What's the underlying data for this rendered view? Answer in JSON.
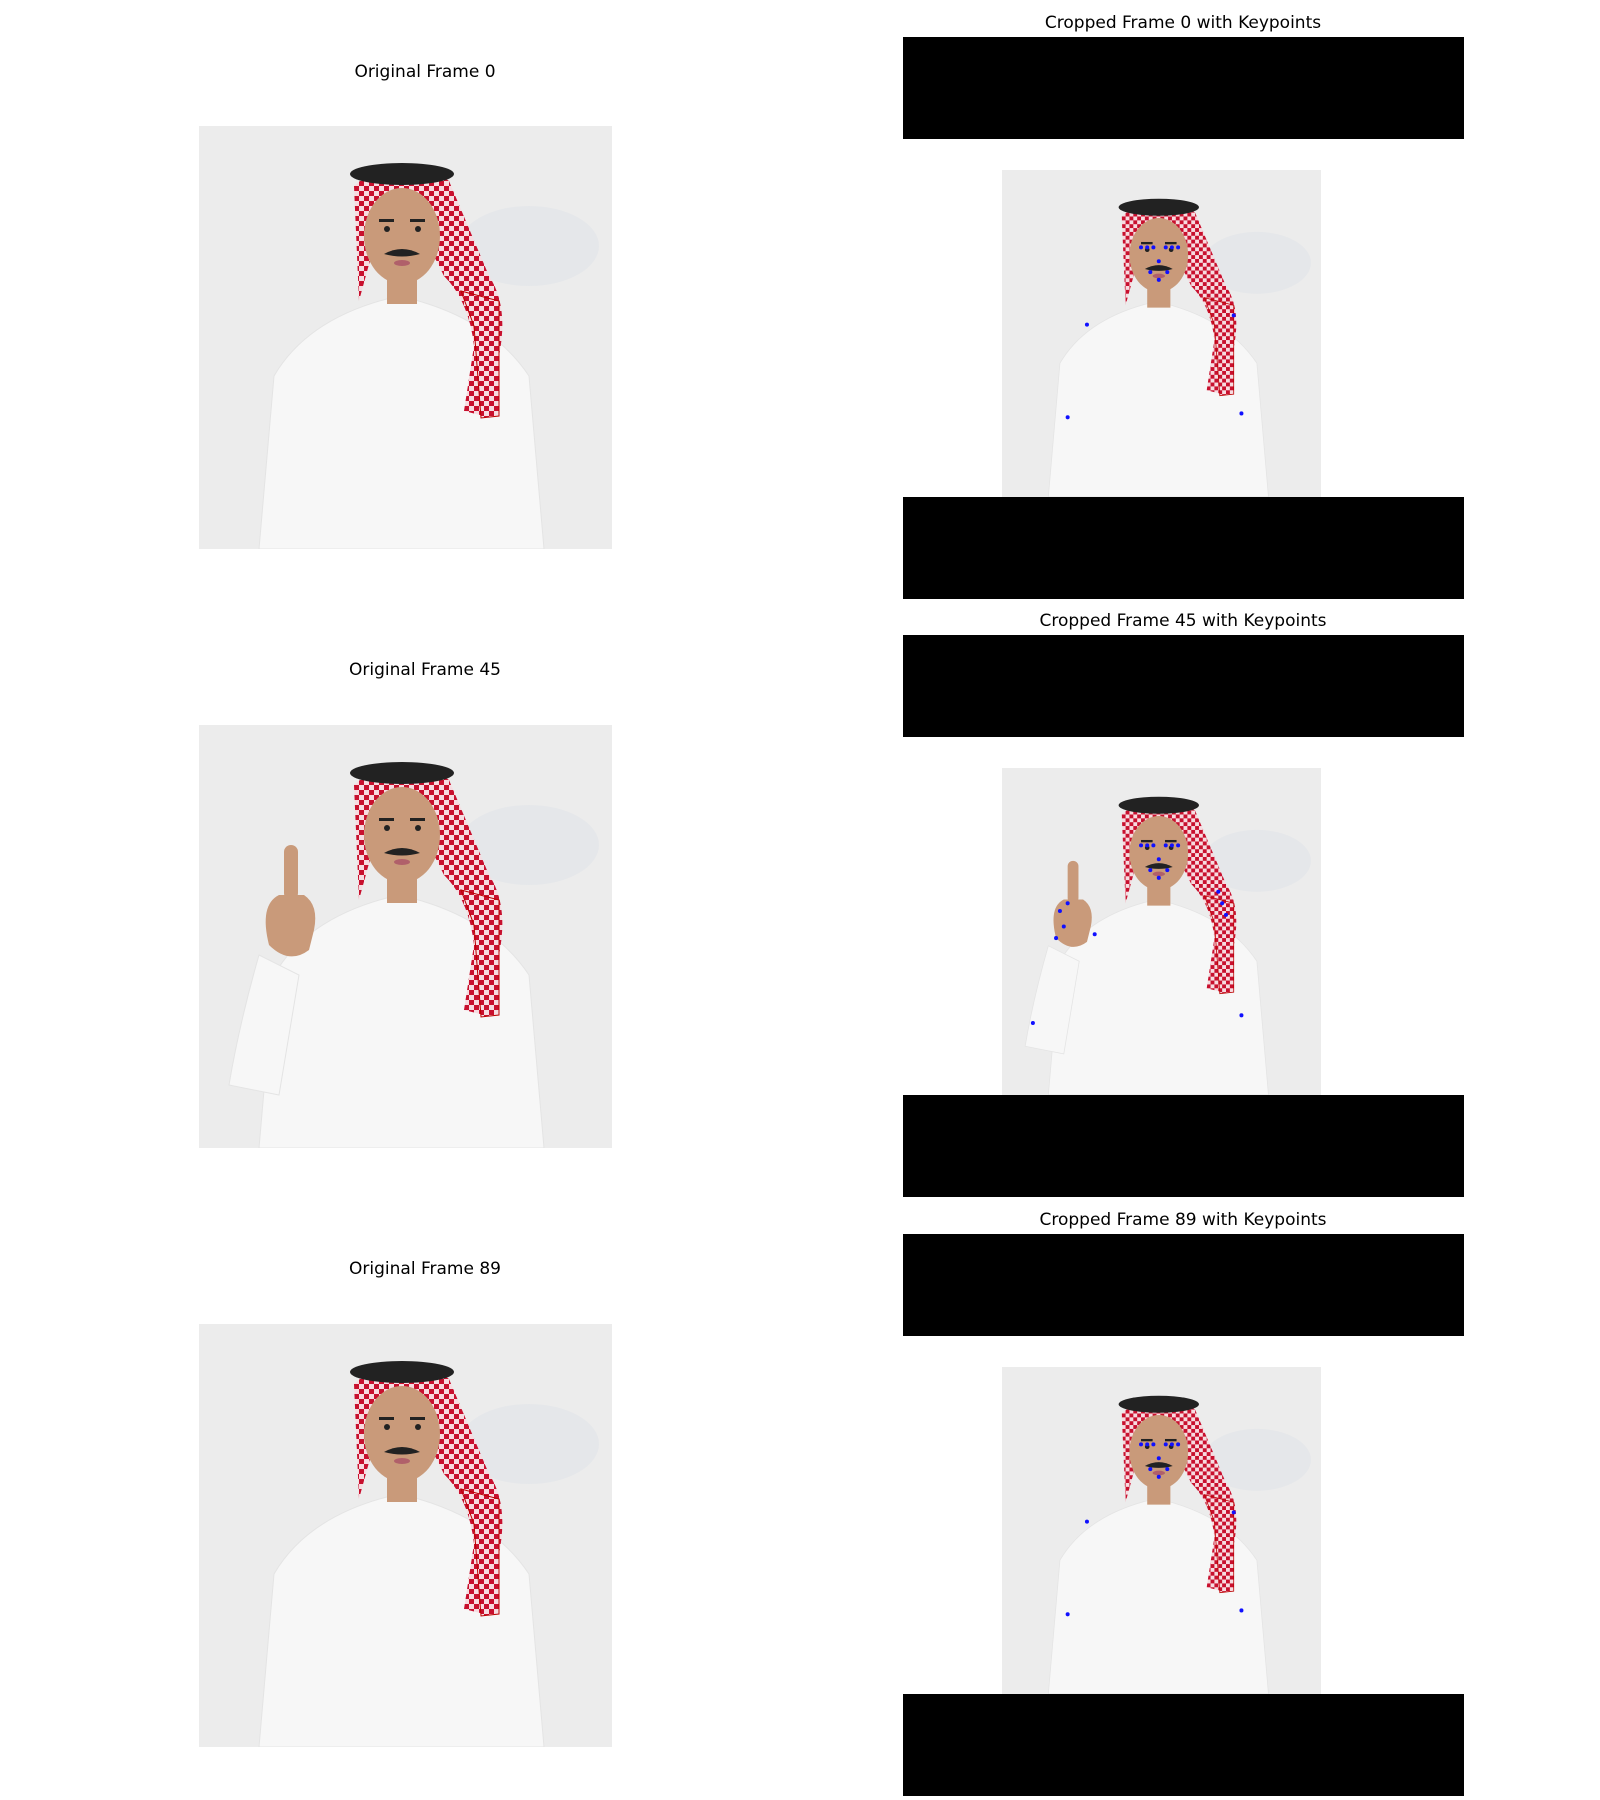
{
  "panels": {
    "original": [
      {
        "title": "Original Frame 0",
        "pose": "neutral"
      },
      {
        "title": "Original Frame 45",
        "pose": "thumbs-up"
      },
      {
        "title": "Original Frame 89",
        "pose": "neutral"
      }
    ],
    "cropped": [
      {
        "title": "Cropped Frame 0 with Keypoints",
        "pose": "neutral"
      },
      {
        "title": "Cropped Frame 45 with Keypoints",
        "pose": "thumbs-up"
      },
      {
        "title": "Cropped Frame 89 with Keypoints",
        "pose": "neutral"
      }
    ]
  },
  "colors": {
    "background": "#ffffff",
    "letterbox": "#000000",
    "keypoint": "#1010ff",
    "ghutra_red": "#c8102e",
    "thobe": "#f7f7f7",
    "skin": "#c99a7a"
  }
}
